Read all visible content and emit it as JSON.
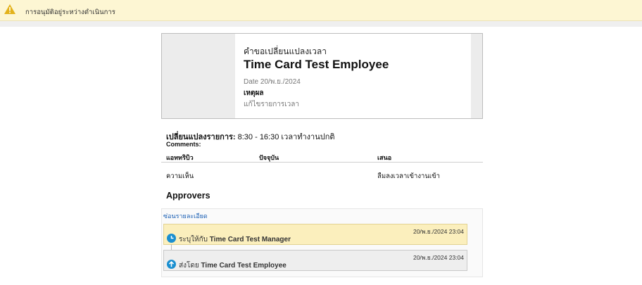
{
  "banner": {
    "message": "การอนุมัติอยู่ระหว่างดำเนินการ",
    "icon": "warning-icon"
  },
  "card": {
    "title": "คำขอเปลี่ยนแปลงเวลา",
    "employee": "Time Card Test Employee",
    "date": "Date 20/พ.ย./2024",
    "reason_label": "เหตุผล",
    "reason": "แก้ไขรายการเวลา"
  },
  "change": {
    "label": "เปลี่ยนแปลงรายการ:",
    "value": " 8:30 - 16:30 เวลาทำงานปกติ"
  },
  "comments": {
    "label": "Comments:",
    "headers": [
      "แอททริบิว",
      "ปัจจุบัน",
      "เสนอ"
    ],
    "row": {
      "attribute": "ความเห็น",
      "current": "",
      "proposed": "ลืมลงเวลาเข้างานเข้า"
    }
  },
  "approvers": {
    "heading": "Approvers",
    "hide_link": "ซ่อนรายละเอียด",
    "steps": [
      {
        "time": "20/พ.ย./2024 23:04",
        "prefix": "ระบุให้กับ",
        "name": "Time Card Test Manager",
        "icon": "clock-icon",
        "color": "#fbefbd"
      },
      {
        "time": "20/พ.ย./2024 23:04",
        "prefix": "ส่งโดย",
        "name": "Time Card Test Employee",
        "icon": "arrow-up-icon",
        "color": "#eeeeee"
      }
    ]
  },
  "colors": {
    "accent": "#1a8fd0",
    "banner": "#fdf6d3",
    "link": "#1a5fb4"
  }
}
